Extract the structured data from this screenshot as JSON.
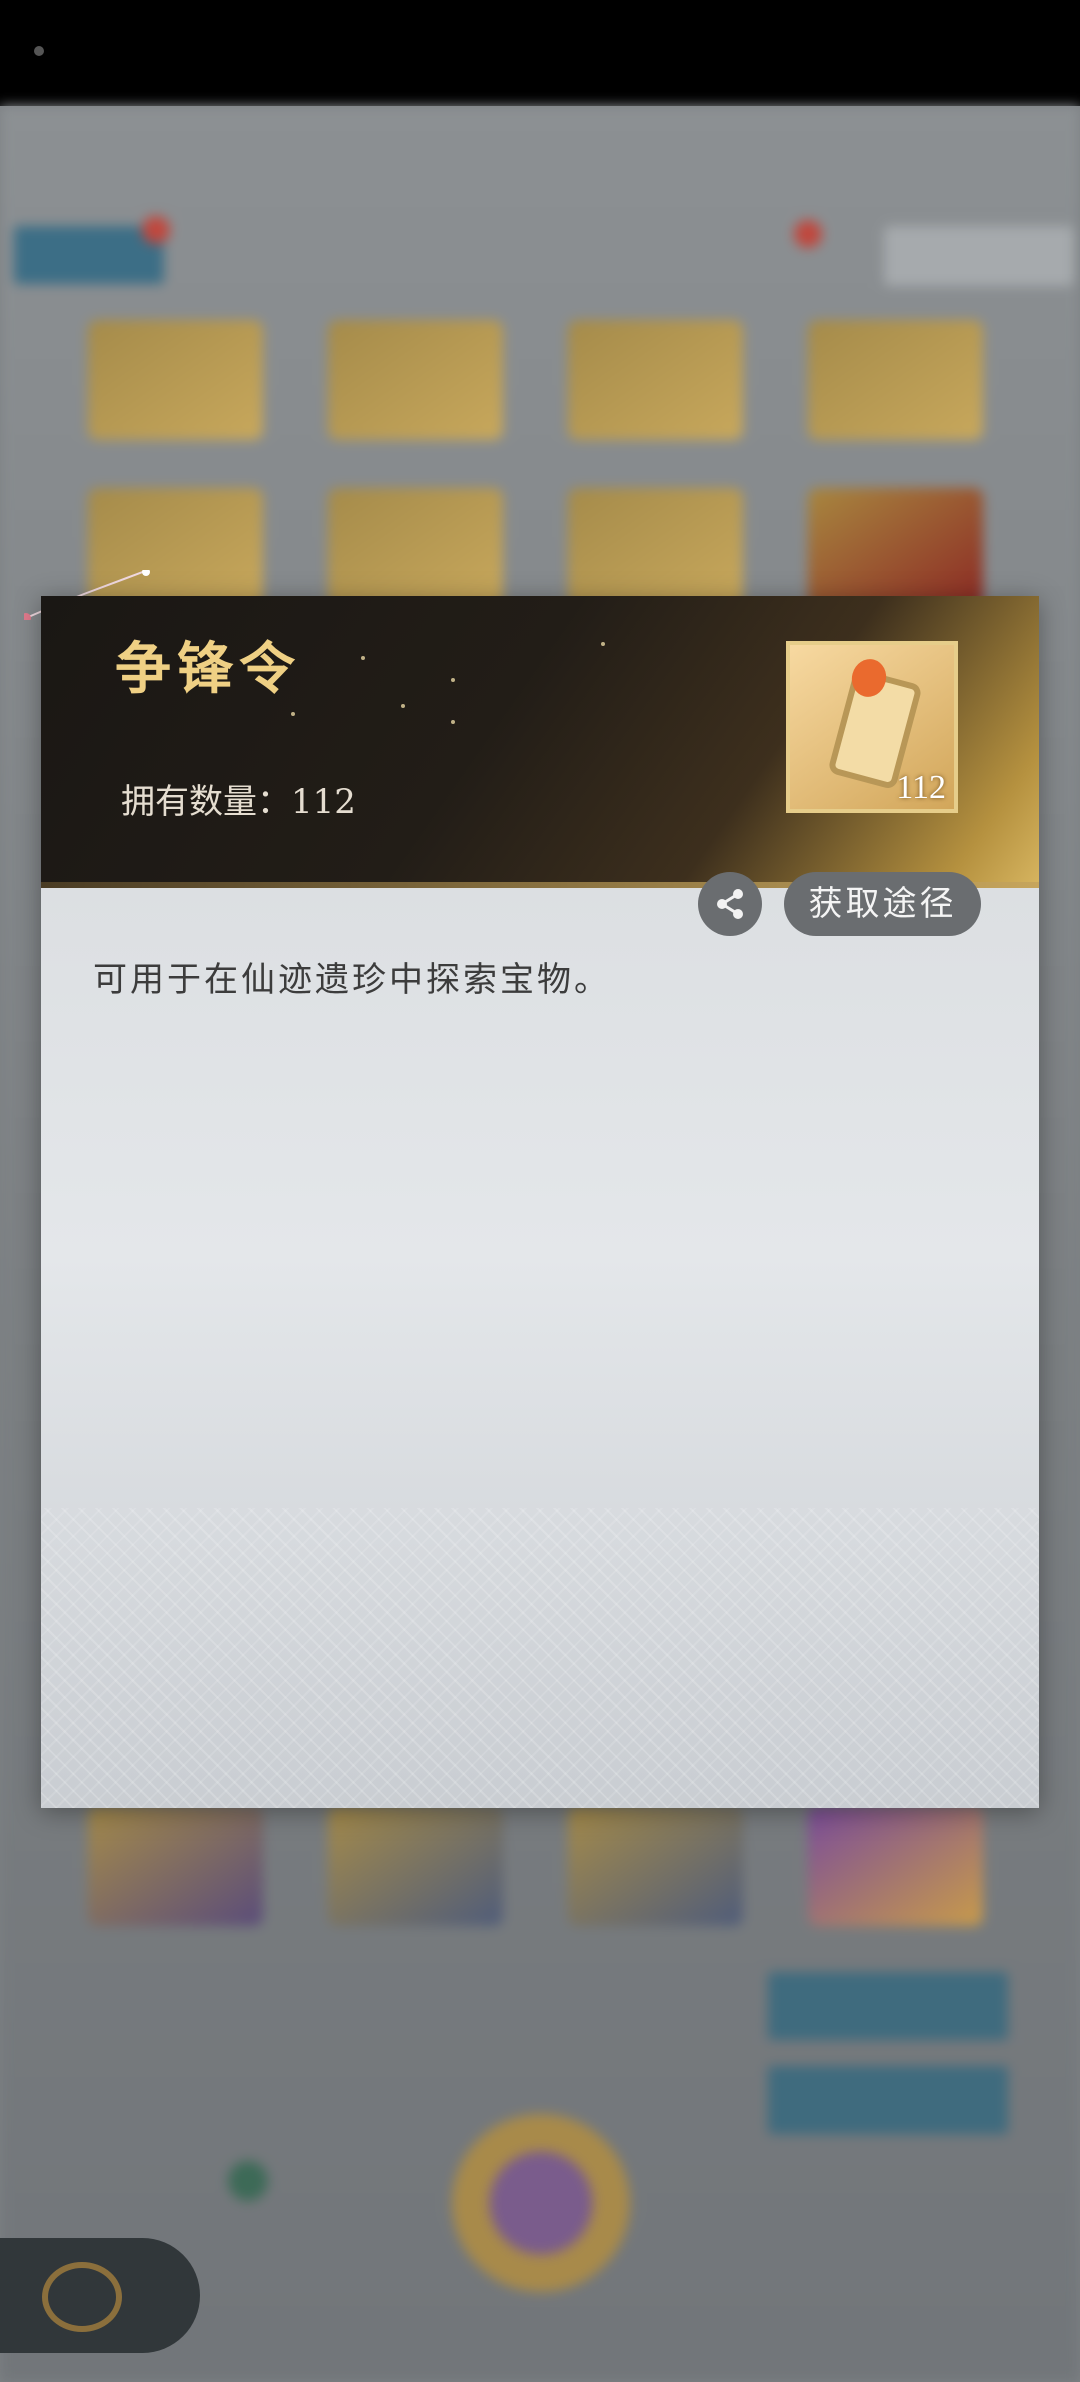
{
  "background": {
    "tabs": [
      "",
      "",
      "",
      "",
      ""
    ],
    "right_button": ""
  },
  "modal": {
    "title": "争锋令",
    "count_label": "拥有数量：",
    "count_value": "112",
    "icon_badge": "112",
    "description": "可用于在仙迹遗珍中探索宝物。",
    "acquire_button": "获取途径",
    "share_icon": "share-icon"
  },
  "colors": {
    "title_gold": "#efd084",
    "button_gray": "#6a6d70",
    "backdrop": "#7d8184"
  }
}
